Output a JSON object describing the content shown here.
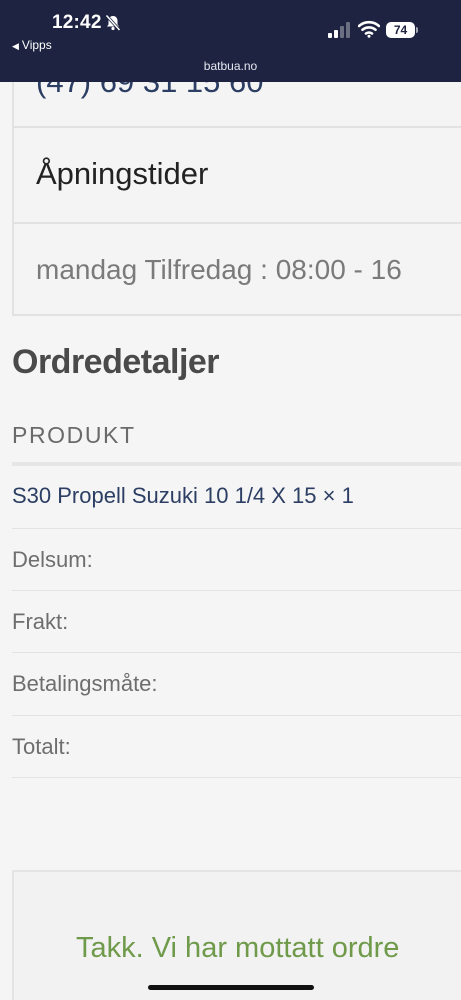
{
  "status_bar": {
    "time": "12:42",
    "back_app": "Vipps",
    "url": "batbua.no",
    "battery": "74",
    "background_color": "#1d2340"
  },
  "store_info": {
    "phone_partial": "(47) 69 31 15 60",
    "hours_heading": "Åpningstider",
    "hours_text": "mandag Tilfredag : 08:00 - 16"
  },
  "order_details": {
    "title": "Ordredetaljer",
    "column_header": "PRODUKT",
    "product": "S30 Propell Suzuki 10 1/4 X 15 × 1",
    "rows": [
      {
        "label": "Delsum:"
      },
      {
        "label": "Frakt:"
      },
      {
        "label": "Betalingsmåte:"
      },
      {
        "label": "Totalt:"
      }
    ]
  },
  "thanks": {
    "text": "Takk. Vi har mottatt ordre",
    "color": "#6f9a4a"
  },
  "icons": {
    "bell": "bell-slash-icon",
    "signal": "cellular-signal-icon",
    "wifi": "wifi-icon",
    "battery": "battery-icon",
    "back": "back-triangle-icon"
  }
}
